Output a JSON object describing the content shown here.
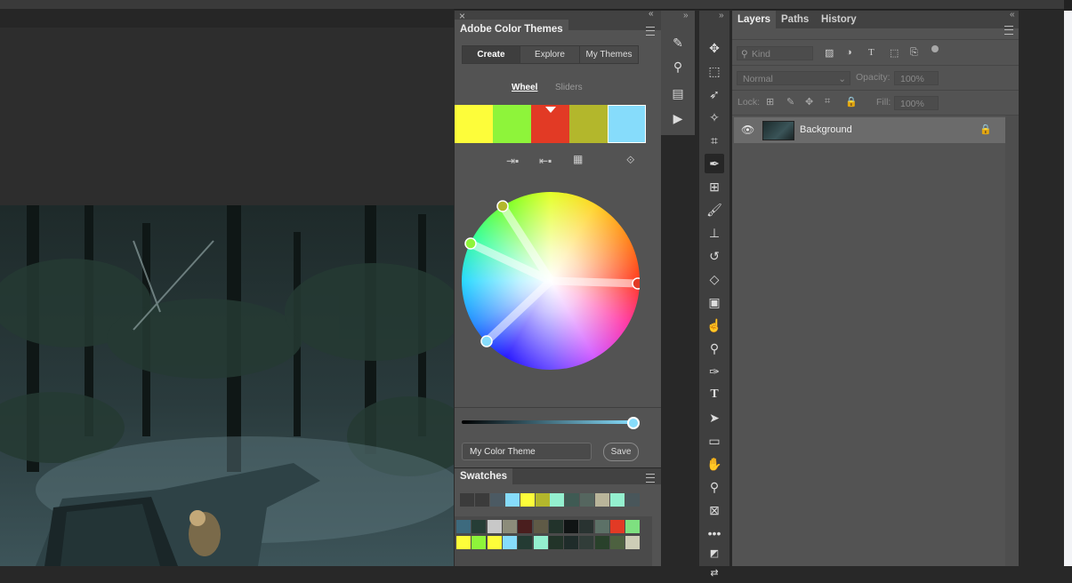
{
  "color_themes": {
    "title": "Adobe Color Themes",
    "modes": [
      "Create",
      "Explore",
      "My Themes"
    ],
    "active_mode": "Create",
    "views": [
      "Wheel",
      "Sliders"
    ],
    "active_view": "Wheel",
    "theme_colors": [
      "#fdfd3a",
      "#8ef43a",
      "#e23a25",
      "#b3b72c",
      "#86dcfb"
    ],
    "theme_name_value": "My Color Theme",
    "save_label": "Save",
    "brightness_level": 1.0
  },
  "swatches": {
    "title": "Swatches",
    "recent": [
      "#3b3b3b",
      "#3b3b3b",
      "#4c5a63",
      "#86dcfb",
      "#fdfd3a",
      "#b3b72c",
      "#94f0cf",
      "#3f5a53",
      "#55665f",
      "#b9b59a",
      "#94f0cf",
      "#49565a"
    ],
    "grid_row1": [
      "#3d6a7e",
      "#263d36",
      "#c8c8c8",
      "#8c8c7a",
      "#4a1e1e",
      "#5f5a46",
      "#22332b",
      "#101414",
      "#293331",
      "#5c7167",
      "#e23a25",
      "#7ee080"
    ],
    "grid_row2": [
      "#fdfd3a",
      "#8ef43a",
      "#fdfd3a",
      "#86dcfb",
      "#243b33",
      "#94f0cf",
      "#223429",
      "#1f2c2a",
      "#313d39",
      "#29412b",
      "#4d6140",
      "#cdcdb6"
    ]
  },
  "layers": {
    "tabs": [
      "Layers",
      "Paths",
      "History"
    ],
    "active_tab": "Layers",
    "filter_placeholder": "Kind",
    "blend_mode": "Normal",
    "opacity_label": "Opacity:",
    "opacity_value": "100%",
    "lock_label": "Lock:",
    "fill_label": "Fill:",
    "fill_value": "100%",
    "items": [
      {
        "name": "Background",
        "visible": true,
        "locked": true
      }
    ]
  },
  "icons": {
    "collapse": "«",
    "expand": "»",
    "close": "×"
  }
}
